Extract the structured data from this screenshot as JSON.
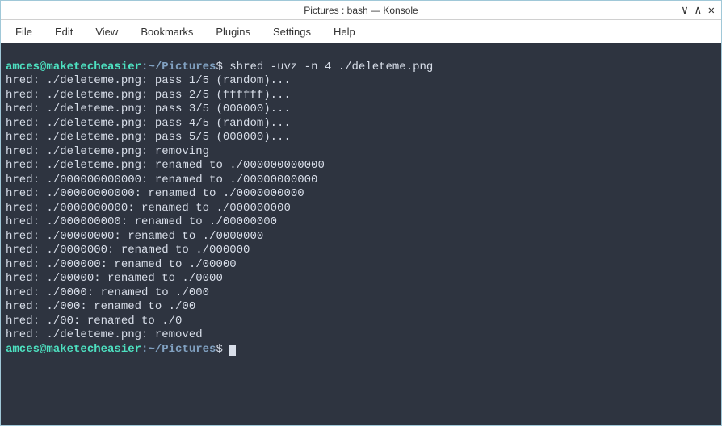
{
  "window": {
    "title": "Pictures : bash — Konsole"
  },
  "menubar": {
    "items": [
      "File",
      "Edit",
      "View",
      "Bookmarks",
      "Plugins",
      "Settings",
      "Help"
    ]
  },
  "terminal": {
    "prompt_user": "amces@maketecheasier",
    "prompt_sep": ":",
    "prompt_path": "~/Pictures",
    "prompt_dollar": "$",
    "command1": " shred -uvz -n 4 ./deleteme.png",
    "lines": [
      "hred: ./deleteme.png: pass 1/5 (random)...",
      "hred: ./deleteme.png: pass 2/5 (ffffff)...",
      "hred: ./deleteme.png: pass 3/5 (000000)...",
      "hred: ./deleteme.png: pass 4/5 (random)...",
      "hred: ./deleteme.png: pass 5/5 (000000)...",
      "hred: ./deleteme.png: removing",
      "hred: ./deleteme.png: renamed to ./000000000000",
      "hred: ./000000000000: renamed to ./00000000000",
      "hred: ./00000000000: renamed to ./0000000000",
      "hred: ./0000000000: renamed to ./000000000",
      "hred: ./000000000: renamed to ./00000000",
      "hred: ./00000000: renamed to ./0000000",
      "hred: ./0000000: renamed to ./000000",
      "hred: ./000000: renamed to ./00000",
      "hred: ./00000: renamed to ./0000",
      "hred: ./0000: renamed to ./000",
      "hred: ./000: renamed to ./00",
      "hred: ./00: renamed to ./0",
      "hred: ./deleteme.png: removed"
    ]
  }
}
